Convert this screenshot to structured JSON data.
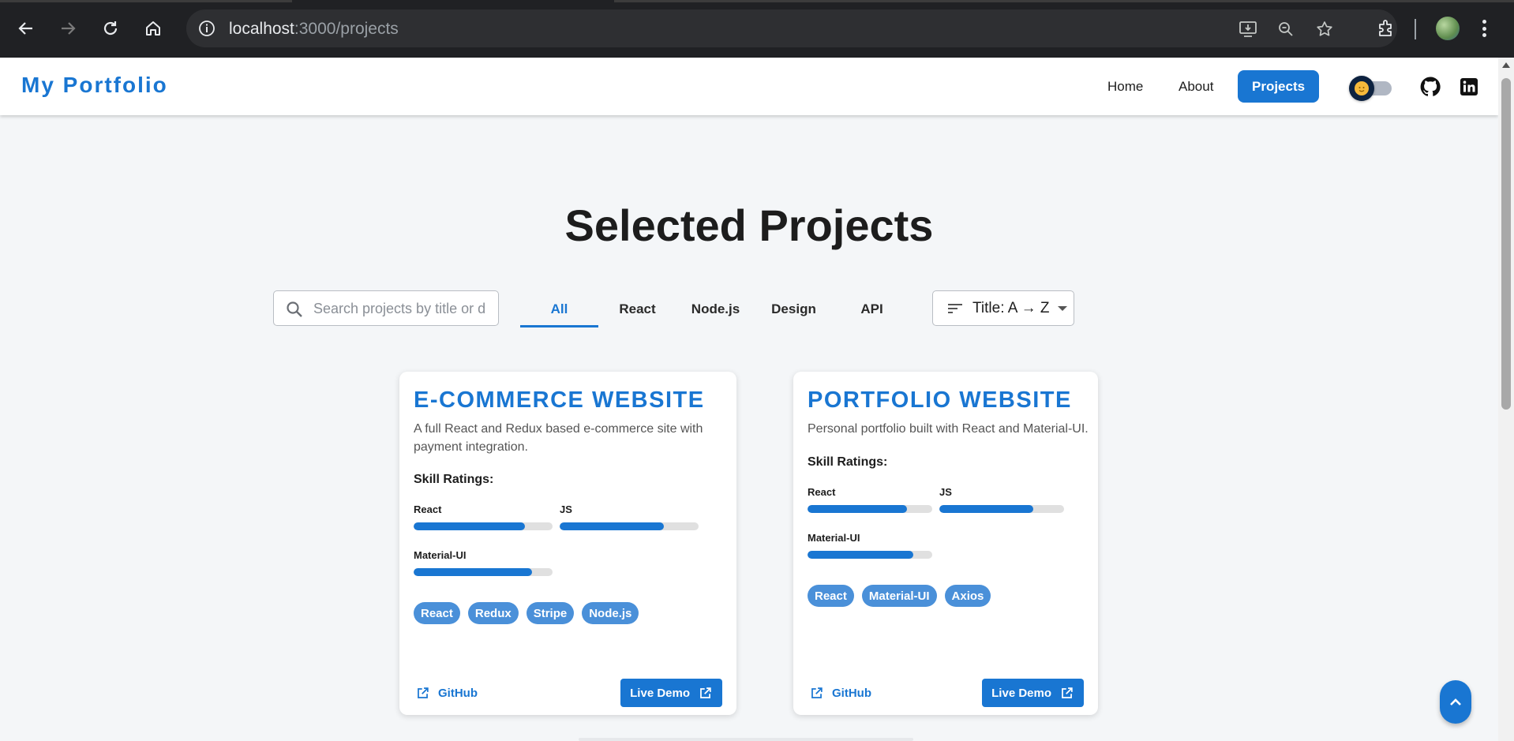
{
  "browser": {
    "url_host": "localhost",
    "url_path": ":3000/projects"
  },
  "header": {
    "brand": "My Portfolio",
    "nav": [
      "Home",
      "About",
      "Projects"
    ],
    "active_nav": "Projects"
  },
  "main": {
    "title": "Selected Projects",
    "search_placeholder": "Search projects by title or d",
    "tabs": [
      "All",
      "React",
      "Node.js",
      "Design",
      "API"
    ],
    "active_tab": "All",
    "sort_label": "Title: A → Z"
  },
  "projects": [
    {
      "title": "E-COMMERCE WEBSITE",
      "description": "A full React and Redux based e-commerce site with payment integration.",
      "skills_heading": "Skill Ratings:",
      "skills": [
        {
          "name": "React",
          "level": 0.8
        },
        {
          "name": "JS",
          "level": 0.75
        },
        {
          "name": "Material-UI",
          "level": 0.85
        }
      ],
      "tags": [
        "React",
        "Redux",
        "Stripe",
        "Node.js"
      ],
      "github_label": "GitHub",
      "demo_label": "Live Demo"
    },
    {
      "title": "PORTFOLIO WEBSITE",
      "description": "Personal portfolio built with React and Material-UI.",
      "skills_heading": "Skill Ratings:",
      "skills": [
        {
          "name": "React",
          "level": 0.8
        },
        {
          "name": "JS",
          "level": 0.75
        },
        {
          "name": "Material-UI",
          "level": 0.85
        }
      ],
      "tags": [
        "React",
        "Material-UI",
        "Axios"
      ],
      "github_label": "GitHub",
      "demo_label": "Live Demo"
    }
  ],
  "colors": {
    "accent": "#1976d2",
    "chip": "#4a90d9",
    "page_bg": "#f4f6f8"
  }
}
